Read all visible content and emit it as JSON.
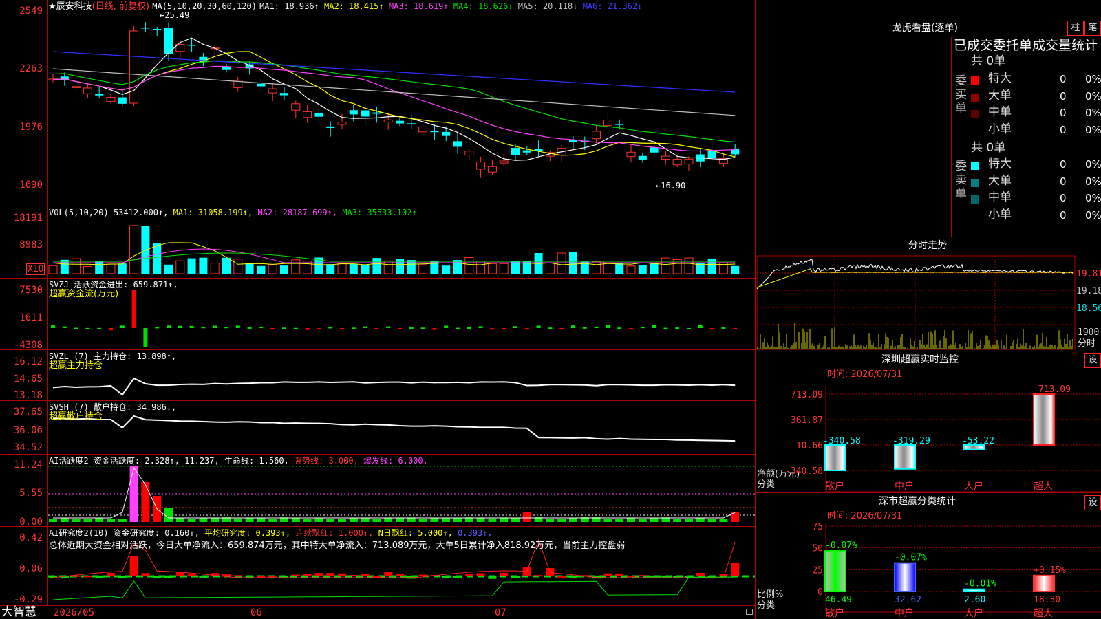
{
  "chart_panel": {
    "stock_name": "★辰安科技",
    "period": "(日线, 前复权)",
    "ma_header": "MA(5,10,20,30,60,120)",
    "ma": [
      {
        "label": "MA1: 18.936↑",
        "color": "#ffffff"
      },
      {
        "label": "MA2: 18.415↑",
        "color": "#ffff00"
      },
      {
        "label": "MA3: 18.619↑",
        "color": "#ff40ff"
      },
      {
        "label": "MA4: 18.626↓",
        "color": "#00e000"
      },
      {
        "label": "MA5: 20.118↓",
        "color": "#c0c0c0"
      },
      {
        "label": "MA6: 21.362↓",
        "color": "#4040ff"
      }
    ],
    "high_label": "←25.49",
    "low_label": "←16.90",
    "price_axis": [
      "2549",
      "2263",
      "1976",
      "1690"
    ],
    "vol": {
      "header": "VOL(5,10,20)",
      "value": "53412.000↑,",
      "ma1": "MA1: 31058.199↑,",
      "ma2": "MA2: 28187.699↑,",
      "ma3": "MA3: 35533.102↑",
      "axis": [
        "18191",
        "8983"
      ],
      "unit": "X10"
    },
    "svzj": {
      "header": "SVZJ  活跃资金进出: 659.871↑,",
      "sub": "超赢资金流(万元)",
      "axis": [
        "7530",
        "1611",
        "-4308"
      ]
    },
    "svzl": {
      "header": "SVZL (7) 主力持仓: 13.898↑,",
      "sub": "超赢主力持仓",
      "axis": [
        "16.12",
        "14.65",
        "13.18"
      ]
    },
    "svsh": {
      "header": "SVSH (7) 散户持仓: 34.986↓,",
      "sub": "超赢散户持仓",
      "axis": [
        "37.65",
        "36.06",
        "34.52"
      ]
    },
    "ai1": {
      "prefix": "AI活跃度2 资金活跃度: 2.328↑,",
      "v2": "11.237,",
      "life": "生命线: 1.560,",
      "strong": "强势线: 3.000,",
      "burst": "爆发线: 6.000,",
      "axis": [
        "11.24",
        "5.55",
        "0.00"
      ]
    },
    "ai2": {
      "prefix": "AI研究度2(10) 资金研究度: 0.160↑,",
      "avg": "平均研究度: 0.393↑,",
      "cont": "连续飘红: 1.000↑,",
      "nday": "N日飘红: 5.000↑,",
      "last": "0.393↑,",
      "summary": "总体近期大资金相对活跃，今日大单净流入：659.874万元，其中特大单净流入：713.089万元，大单5日累计净入818.92万元，当前主力控盘弱",
      "axis": [
        "0.42",
        "0.06",
        "-0.29"
      ]
    },
    "bottom": {
      "brand": "大智慧",
      "dates": [
        "2026/05",
        "06",
        "07"
      ]
    }
  },
  "right_panel": {
    "lhb": {
      "title": "龙虎看盘(逐单)",
      "btn_zhu": "柱",
      "btn_bi": "笔",
      "header": "已成交委托单成交量统计",
      "buy": {
        "side": "委买单",
        "total": "共 0单",
        "rows": [
          {
            "name": "特大",
            "val": "0",
            "pct": "0%",
            "color": "#ff0000"
          },
          {
            "name": "大单",
            "val": "0",
            "pct": "0%",
            "color": "#900000"
          },
          {
            "name": "中单",
            "val": "0",
            "pct": "0%",
            "color": "#600000"
          },
          {
            "name": "小单",
            "val": "0",
            "pct": "0%",
            "color": ""
          }
        ]
      },
      "sell": {
        "side": "委卖单",
        "total": "共 0单",
        "rows": [
          {
            "name": "特大",
            "val": "0",
            "pct": "0%",
            "color": "#00ffff"
          },
          {
            "name": "大单",
            "val": "0",
            "pct": "0%",
            "color": "#008080"
          },
          {
            "name": "中单",
            "val": "0",
            "pct": "0%",
            "color": "#006868"
          },
          {
            "name": "小单",
            "val": "0",
            "pct": "0%",
            "color": ""
          }
        ]
      }
    },
    "fenshi": {
      "title": "分时走势",
      "axis": [
        "19.81",
        "19.18",
        "18.56"
      ],
      "vol_label": "1900",
      "unit": "分时"
    },
    "monitor": {
      "title": "深圳超赢实时监控",
      "set_btn": "设",
      "time": "时间: 2026/07/31",
      "axis": [
        "713.09",
        "361.87",
        "10.66",
        "-340.58"
      ],
      "ylabel1": "净额(万元)",
      "ylabel2": "分类",
      "categories": [
        "散户",
        "中户",
        "大户",
        "超大"
      ],
      "values": [
        -340.58,
        -319.29,
        -53.22,
        713.09
      ],
      "labels": [
        "-340.58",
        "-319.29",
        "-53.22",
        "713.09"
      ]
    },
    "classify": {
      "title": "深市超赢分类统计",
      "set_btn": "设",
      "time": "时间: 2026/07/31",
      "axis": [
        "75",
        "50",
        "25",
        "0"
      ],
      "ylabel1": "比例%",
      "ylabel2": "分类",
      "categories": [
        "散户",
        "中户",
        "大户",
        "超大"
      ],
      "values": [
        46.49,
        32.62,
        2.6,
        18.3
      ],
      "value_labels": [
        "46.49",
        "32.62",
        "2.60",
        "18.30"
      ],
      "changes": [
        "-0.07%",
        "-0.07%",
        "-0.01%",
        "+0.15%"
      ]
    }
  },
  "colors": {
    "border": "#b00000",
    "up": "#ff3232",
    "down": "#00ffff",
    "bg": "#000000"
  }
}
